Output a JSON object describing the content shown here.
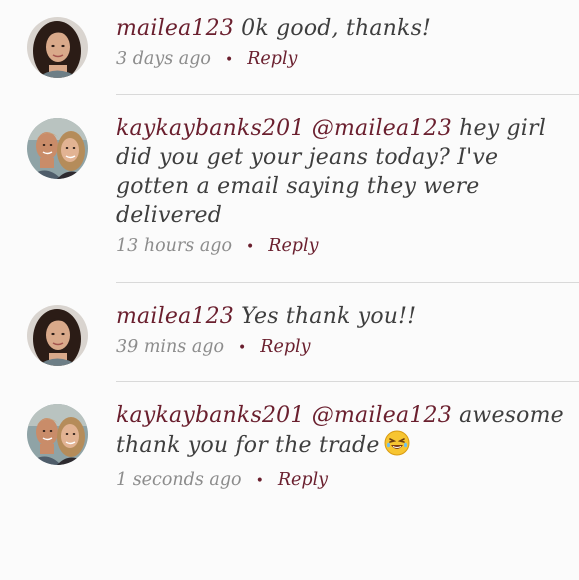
{
  "comments": [
    {
      "username": "mailea123",
      "text": " 0k good, thanks!",
      "time": "3 days ago",
      "reply_label": "Reply",
      "avatar": "female-avatar"
    },
    {
      "username": "kaykaybanks201",
      "mention": " @mailea123",
      "text": " hey girl did you get your jeans today? I've gotten a email saying they were delivered",
      "time": "13 hours ago",
      "reply_label": "Reply",
      "avatar": "couple-avatar"
    },
    {
      "username": "mailea123",
      "text": " Yes thank you!!",
      "time": "39 mins ago",
      "reply_label": "Reply",
      "avatar": "female-avatar"
    },
    {
      "username": "kaykaybanks201",
      "mention": " @mailea123",
      "text": " awesome thank you for the trade",
      "emoji": "laughing-emoji",
      "time": "1 seconds ago",
      "reply_label": "Reply",
      "avatar": "couple-avatar"
    }
  ],
  "colors": {
    "accent": "#6a1f2e",
    "meta": "#8c8c8c",
    "divider": "#d9d9d9",
    "background": "#fbfbfb"
  }
}
